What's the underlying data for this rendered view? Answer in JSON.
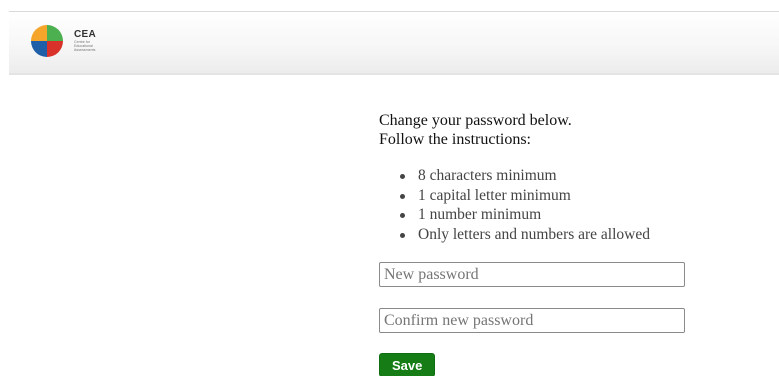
{
  "header": {
    "logo": {
      "abbr": "CEA",
      "subtitle_lines": [
        "Centre for",
        "Educational",
        "Assessments"
      ],
      "colors": {
        "orange": "#f4a52a",
        "green": "#4caf50",
        "red": "#d9322b",
        "blue": "#1f5fa8"
      }
    }
  },
  "form": {
    "intro_line1": "Change your password below.",
    "intro_line2": "Follow the instructions:",
    "rules": [
      "8 characters minimum",
      "1 capital letter minimum",
      "1 number minimum",
      "Only letters and numbers are allowed"
    ],
    "new_password": {
      "placeholder": "New password",
      "value": ""
    },
    "confirm_password": {
      "placeholder": "Confirm new password",
      "value": ""
    },
    "save_label": "Save",
    "save_color": "#167d16"
  }
}
